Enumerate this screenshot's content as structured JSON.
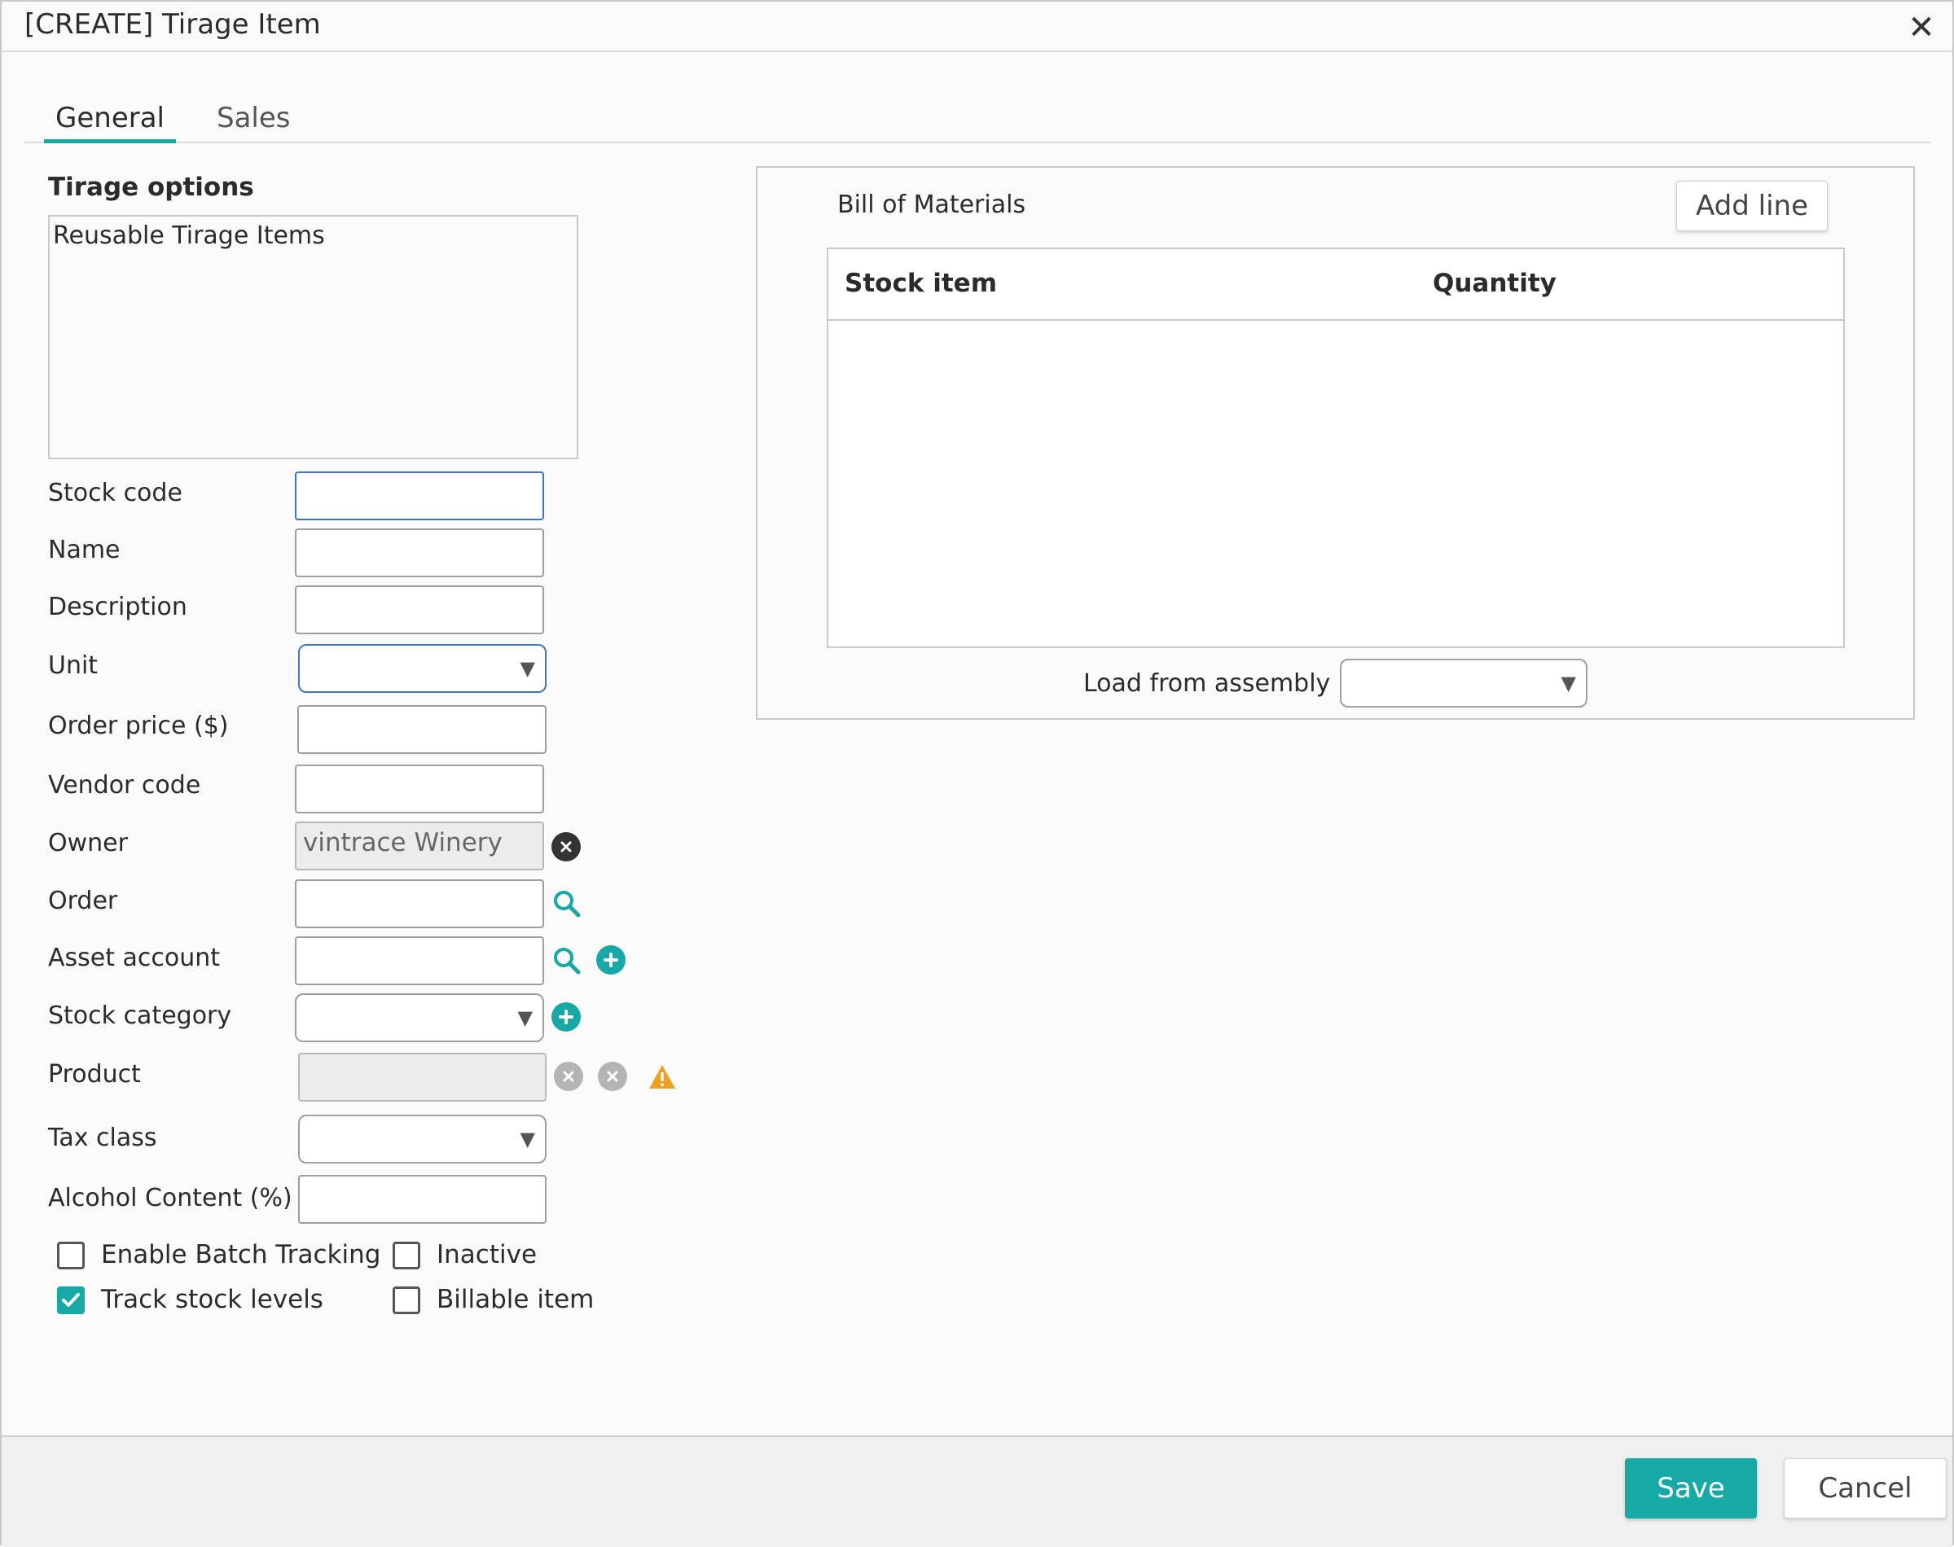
{
  "window": {
    "title": "[CREATE] Tirage Item",
    "close_icon": "close-icon"
  },
  "tabs": [
    {
      "label": "General",
      "active": true
    },
    {
      "label": "Sales",
      "active": false
    }
  ],
  "tirage_options": {
    "title": "Tirage options",
    "items": [
      "Reusable Tirage Items"
    ]
  },
  "form": {
    "stock_code": {
      "label": "Stock code",
      "value": ""
    },
    "name": {
      "label": "Name",
      "value": ""
    },
    "description": {
      "label": "Description",
      "value": ""
    },
    "unit": {
      "label": "Unit",
      "value": ""
    },
    "order_price": {
      "label": "Order price ($)",
      "value": ""
    },
    "vendor_code": {
      "label": "Vendor code",
      "value": ""
    },
    "owner": {
      "label": "Owner",
      "value": "vintrace Winery"
    },
    "order": {
      "label": "Order",
      "value": ""
    },
    "asset_account": {
      "label": "Asset account",
      "value": ""
    },
    "stock_category": {
      "label": "Stock category",
      "value": ""
    },
    "product": {
      "label": "Product",
      "value": ""
    },
    "tax_class": {
      "label": "Tax class",
      "value": ""
    },
    "alcohol_content": {
      "label": "Alcohol Content (%)",
      "value": ""
    }
  },
  "checkboxes": {
    "enable_batch_tracking": {
      "label": "Enable Batch Tracking",
      "checked": false
    },
    "inactive": {
      "label": "Inactive",
      "checked": false
    },
    "track_stock_levels": {
      "label": "Track stock levels",
      "checked": true
    },
    "billable_item": {
      "label": "Billable item",
      "checked": false
    }
  },
  "bom": {
    "title": "Bill of Materials",
    "add_line_label": "Add line",
    "columns": [
      "Stock item",
      "Quantity"
    ],
    "rows": [],
    "load_from_assembly_label": "Load from assembly",
    "load_from_assembly_value": ""
  },
  "footer": {
    "save_label": "Save",
    "cancel_label": "Cancel"
  },
  "colors": {
    "accent": "#16a9a5",
    "focus": "#3f73d1",
    "warning": "#f0a020"
  }
}
